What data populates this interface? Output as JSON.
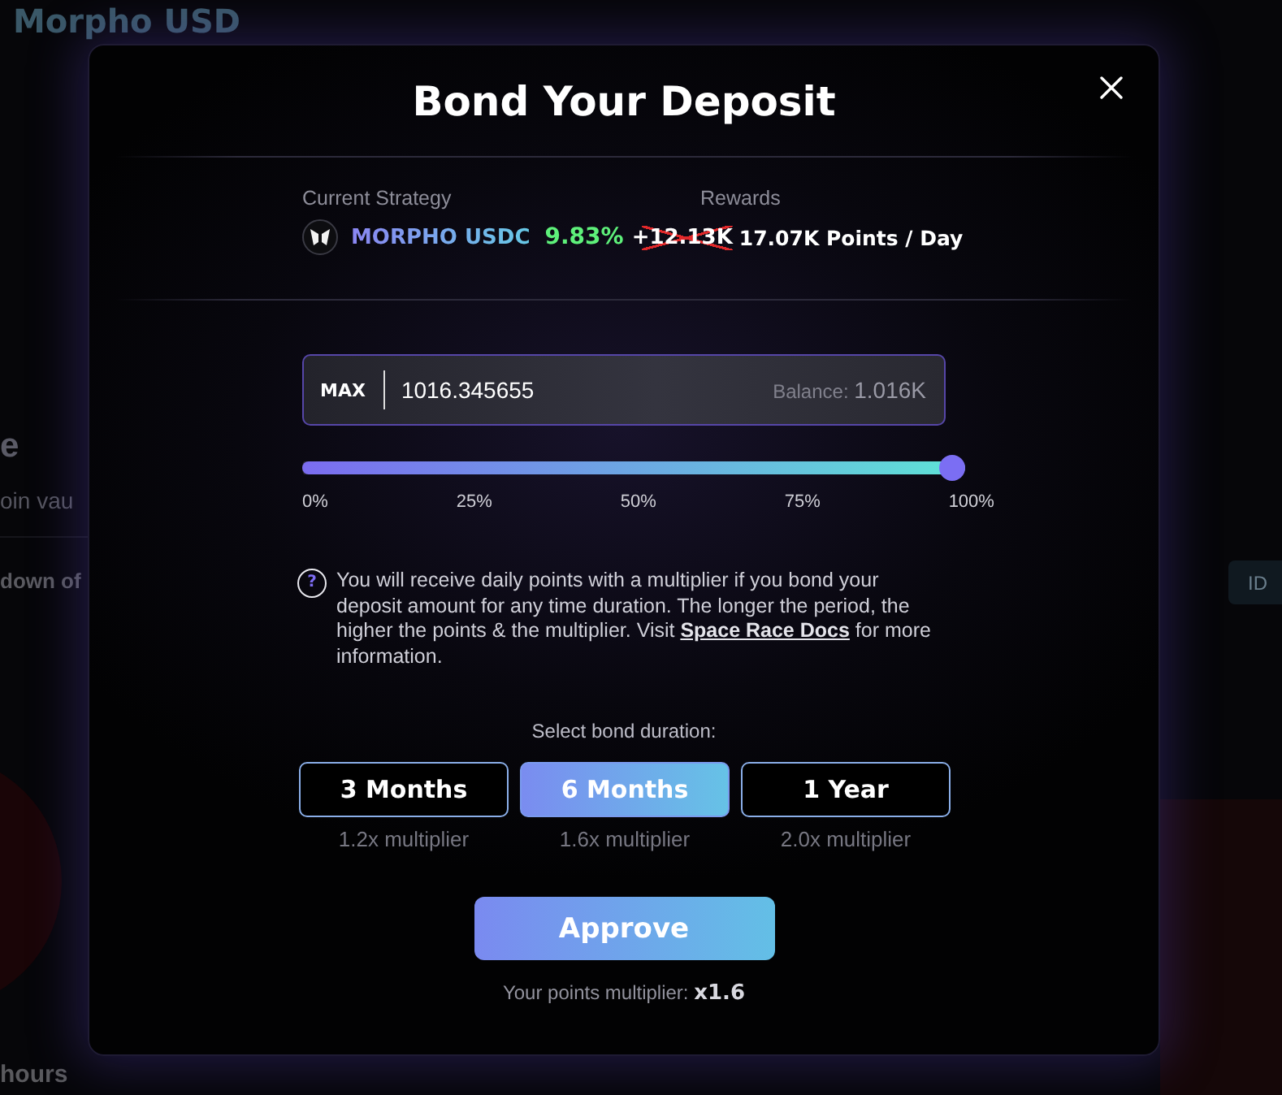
{
  "background_page": {
    "title": "Morpho USD",
    "heading": "e",
    "subtitle": "oin vau",
    "section_heading": "down of",
    "footer_heading": "hours",
    "side_button": "ID"
  },
  "modal": {
    "title": "Bond Your Deposit",
    "strategy": {
      "label": "Current Strategy",
      "name": "MORPHO USDC",
      "apy": "9.83%"
    },
    "rewards": {
      "label": "Rewards",
      "old_value": "+12.13K",
      "value": "17.07K Points / Day"
    },
    "amount": {
      "max_label": "MAX",
      "value": "1016.345655",
      "balance_label": "Balance:",
      "balance_value": "1.016K"
    },
    "amount_slider": {
      "level": 1,
      "ticks": [
        "0%",
        "25%",
        "50%",
        "75%",
        "100%"
      ]
    },
    "info": {
      "icon": "?",
      "text_before": "You will receive daily points with a multiplier if you bond your deposit amount for any time duration. The longer the period, the higher the points & the multiplier. Visit",
      "link": "Space Race Docs",
      "text_after": "for more information."
    },
    "duration_label": "Select bond duration:",
    "durations": [
      {
        "label": "3 Months",
        "multiplier": "1.2x multiplier",
        "selected": false
      },
      {
        "label": "6 Months",
        "multiplier": "1.6x multiplier",
        "selected": true
      },
      {
        "label": "1 Year",
        "multiplier": "2.0x multiplier",
        "selected": false
      }
    ],
    "approve_button": "Approve",
    "footer": "Your points multiplier: **x1.6**"
  }
}
